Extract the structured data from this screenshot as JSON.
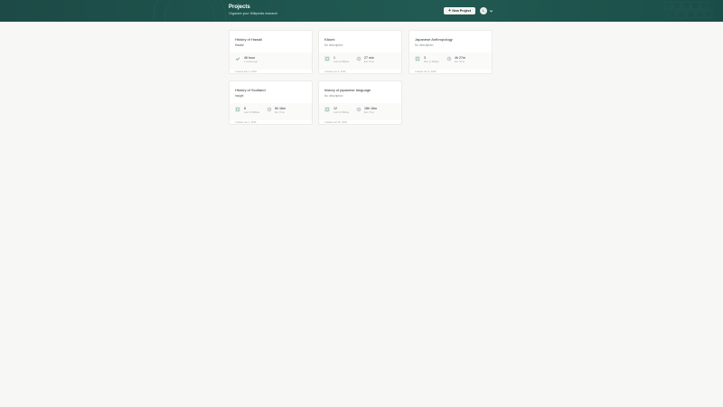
{
  "header": {
    "title": "Projects",
    "subtitle": "Organize your Wikipedia research",
    "new_project_label": "New Project",
    "avatar_initial": "L"
  },
  "colors": {
    "header_dark": "#1d4a46",
    "accent": "#5a9a7c",
    "card_bg": "#ffffff",
    "page_bg": "#f7f7f6"
  },
  "projects": [
    {
      "title": "History of Hawaii",
      "description": "Hawaii",
      "stat1_value": "",
      "stat1_label": "",
      "stat2_value": "46 hour",
      "stat2_label": "1 minute ago",
      "updated": "Created Dec 4, 2025"
    },
    {
      "title": "Kāomi",
      "description": "No description",
      "stat1_value": "1",
      "stat1_label": "Last 24 Wikipa",
      "stat2_value": "27 min",
      "stat2_label": "Est. Time",
      "updated": "Created Jan 6, 2026"
    },
    {
      "title": "Japanese Anthropology",
      "description": "No description",
      "stat1_value": "3",
      "stat1_label": "Res. in Wikipa",
      "stat2_value": "4h 27m",
      "stat2_label": "Est. Time",
      "updated": "Created Jan 6, 2026"
    },
    {
      "title": "History of Scotland",
      "description": "Insight",
      "stat1_value": "6",
      "stat1_label": "Last 24 Wikipa",
      "stat2_value": "5h 16m",
      "stat2_label": "Est. Time",
      "updated": "Created Jan 1, 2026"
    },
    {
      "title": "history of japanese language",
      "description": "No description",
      "stat1_value": "12",
      "stat1_label": "Last 24 Wikipa",
      "stat2_value": "18h 16m",
      "stat2_label": "Est. Time",
      "updated": "Created Jan 26, 2026"
    }
  ]
}
